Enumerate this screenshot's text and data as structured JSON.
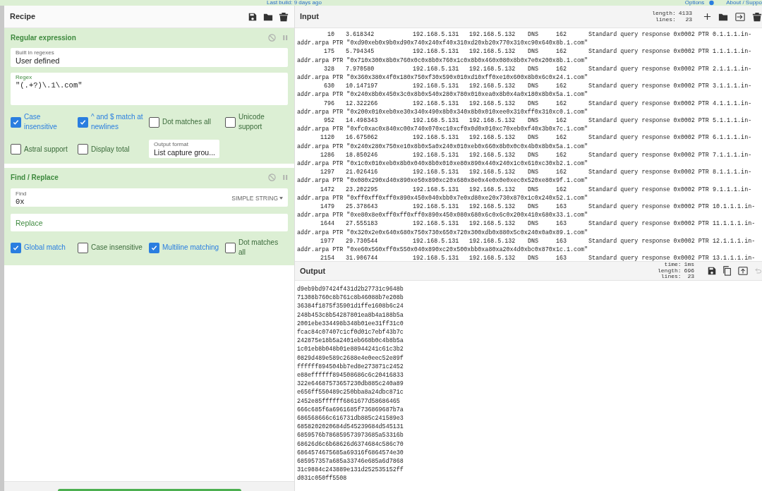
{
  "top_bar": {
    "build": "Last build: 9 days ago",
    "options": "Options",
    "about": "About / Suppo"
  },
  "recipe": {
    "title": "Recipe",
    "operations": [
      {
        "kind": "regex",
        "title": "Regular expression",
        "built_in": {
          "label": "Built in regexes",
          "value": "User defined"
        },
        "regex": {
          "label": "Regex",
          "value": "\"(.+?)\\.1\\.com\""
        },
        "options": [
          {
            "label": "Case insensitive",
            "checked": true
          },
          {
            "label": "^ and $ match at newlines",
            "checked": true
          },
          {
            "label": "Dot matches all",
            "checked": false
          },
          {
            "label": "Unicode support",
            "checked": false
          },
          {
            "label": "Astral support",
            "checked": false
          },
          {
            "label": "Display total",
            "checked": false
          }
        ],
        "output_format": {
          "label": "Output format",
          "value": "List capture grou..."
        }
      },
      {
        "kind": "find_replace",
        "title": "Find / Replace",
        "find": {
          "label": "Find",
          "value": "0x",
          "mode": "SIMPLE STRING"
        },
        "replace": {
          "placeholder": "Replace"
        },
        "options": [
          {
            "label": "Global match",
            "checked": true
          },
          {
            "label": "Case insensitive",
            "checked": false
          },
          {
            "label": "Multiline matching",
            "checked": true
          },
          {
            "label": "Dot matches all",
            "checked": false
          }
        ]
      }
    ]
  },
  "input": {
    "title": "Input",
    "length_label": "length:",
    "length": "4133",
    "lines_label": "lines:",
    "lines": "23",
    "records": [
      {
        "no": "10",
        "time": "3.618342",
        "source": "192.168.5.131",
        "destination": "192.168.5.132",
        "protocol": "DNS",
        "length": "162",
        "info": "Standard query response 0x0002 PTR 0.1.1.1.in-",
        "continuation": "addr.arpa PTR \"0xd90xeb0x9b0xd90x740x240xf40x310xd20xb20x770x310xc90x640x8b.1.com\""
      },
      {
        "no": "175",
        "time": "5.794345",
        "source": "192.168.5.131",
        "destination": "192.168.5.132",
        "protocol": "DNS",
        "length": "162",
        "info": "Standard query response 0x0002 PTR 1.1.1.1.in-",
        "continuation": "addr.arpa PTR \"0x710x300x8b0x760x0c0x8b0x760x1c0x8b0x460x080x8b0x7e0x200x8b.1.com\""
      },
      {
        "no": "328",
        "time": "7.970580",
        "source": "192.168.5.131",
        "destination": "192.168.5.132",
        "protocol": "DNS",
        "length": "162",
        "info": "Standard query response 0x0002 PTR 2.1.1.1.in-",
        "continuation": "addr.arpa PTR \"0x360x380x4f0x180x750xf30x590x010xd10xff0xe10x600x8b0x6c0x24.1.com\""
      },
      {
        "no": "630",
        "time": "10.147197",
        "source": "192.168.5.131",
        "destination": "192.168.5.132",
        "protocol": "DNS",
        "length": "162",
        "info": "Standard query response 0x0002 PTR 3.1.1.1.in-",
        "continuation": "addr.arpa PTR \"0x240x8b0x450x3c0x8b0x540x280x780x010xea0x8b0x4a0x180x8b0x5a.1.com\""
      },
      {
        "no": "796",
        "time": "12.322266",
        "source": "192.168.5.131",
        "destination": "192.168.5.132",
        "protocol": "DNS",
        "length": "162",
        "info": "Standard query response 0x0002 PTR 4.1.1.1.in-",
        "continuation": "addr.arpa PTR \"0x200x010xeb0xe30x340x490x8b0x340x8b0x010xee0x310xff0x310xc0.1.com\""
      },
      {
        "no": "952",
        "time": "14.498343",
        "source": "192.168.5.131",
        "destination": "192.168.5.132",
        "protocol": "DNS",
        "length": "162",
        "info": "Standard query response 0x0002 PTR 5.1.1.1.in-",
        "continuation": "addr.arpa PTR \"0xfc0xac0x840xc00x740x070xc10xcf0x0d0x010xc70xeb0xf40x3b0x7c.1.com\""
      },
      {
        "no": "1120",
        "time": "16.675062",
        "source": "192.168.5.131",
        "destination": "192.168.5.132",
        "protocol": "DNS",
        "length": "162",
        "info": "Standard query response 0x0002 PTR 6.1.1.1.in-",
        "continuation": "addr.arpa PTR \"0x240x280x750xe10x8b0x5a0x240x010xeb0x660x8b0x0c0x4b0x8b0x5a.1.com\""
      },
      {
        "no": "1286",
        "time": "18.850246",
        "source": "192.168.5.131",
        "destination": "192.168.5.132",
        "protocol": "DNS",
        "length": "162",
        "info": "Standard query response 0x0002 PTR 7.1.1.1.in-",
        "continuation": "addr.arpa PTR \"0x1c0x010xeb0x8b0x040x8b0x010xe80x890x440x240x1c0x610xc30xb2.1.com\""
      },
      {
        "no": "1297",
        "time": "21.026416",
        "source": "192.168.5.131",
        "destination": "192.168.5.132",
        "protocol": "DNS",
        "length": "162",
        "info": "Standard query response 0x0002 PTR 8.1.1.1.in-",
        "continuation": "addr.arpa PTR \"0x080x290xd40x890xe50x890xc20x680x8e0x4e0x0e0xec0x520xe80x9f.1.com\""
      },
      {
        "no": "1472",
        "time": "23.202295",
        "source": "192.168.5.131",
        "destination": "192.168.5.132",
        "protocol": "DNS",
        "length": "162",
        "info": "Standard query response 0x0002 PTR 9.1.1.1.in-",
        "continuation": "addr.arpa PTR \"0xff0xff0xff0x890x450x040xbb0x7e0xd80xe20x730x870x1c0x240x52.1.com\""
      },
      {
        "no": "1479",
        "time": "25.378643",
        "source": "192.168.5.131",
        "destination": "192.168.5.132",
        "protocol": "DNS",
        "length": "163",
        "info": "Standard query response 0x0002 PTR 10.1.1.1.in-",
        "continuation": "addr.arpa PTR \"0xe80x8e0xff0xff0xff0x890x450x080x680x6c0x6c0x200x410x680x33.1.com\""
      },
      {
        "no": "1644",
        "time": "27.555183",
        "source": "192.168.5.131",
        "destination": "192.168.5.132",
        "protocol": "DNS",
        "length": "163",
        "info": "Standard query response 0x0002 PTR 11.1.1.1.in-",
        "continuation": "addr.arpa PTR \"0x320x2e0x640x680x750x730x650x720x300xdb0x880x5c0x240x0a0x89.1.com\""
      },
      {
        "no": "1977",
        "time": "29.730544",
        "source": "192.168.5.131",
        "destination": "192.168.5.132",
        "protocol": "DNS",
        "length": "163",
        "info": "Standard query response 0x0002 PTR 12.1.1.1.in-",
        "continuation": "addr.arpa PTR \"0xe60x560xff0x550x040x890xc20x500xbb0xa80xa20x4d0xbc0x870x1c.1.com\""
      },
      {
        "no": "2154",
        "time": "31.906744",
        "source": "192.168.5.131",
        "destination": "192.168.5.132",
        "protocol": "DNS",
        "length": "163",
        "info": "Standard query response 0x0002 PTR 13.1.1.1.in-"
      }
    ]
  },
  "output": {
    "title": "Output",
    "time_label": "time:",
    "time": "1ms",
    "length_label": "length:",
    "length": "696",
    "lines_label": "lines:",
    "lines": "23",
    "lines_text": [
      "d9eb9bd97424f431d2b27731c9648b",
      "71308b760c8b761c8b46088b7e208b",
      "36384f1875f35901d1ffe1608b6c24",
      "248b453c8b54287801ea8b4a188b5a",
      "2001ebe334498b348b01ee31ff31c0",
      "fcac84c07407c1cf0d01c7ebf43b7c",
      "242875e18b5a2401eb668b0c4b8b5a",
      "1c01eb8b048b01e88944241c61c3b2",
      "0829d489e589c2688e4e0eec52e89f",
      "ffffff894504bb7ed8e273871c2452",
      "e88effffff894508686c6c20416833",
      "322e64687573657230db885c240a89",
      "e656ff550489c250bba8a24dbc871c",
      "2452e85ffffff6861677d58686465",
      "666c685f6a6961685f736869687b7a",
      "686568666c616731db885c241589e3",
      "6858202020684d545239684d545131",
      "6859576b786859573973685a53316b",
      "68626d6c6b68626d6374684c586c70",
      "6864574675685a69316f6864574e30",
      "685957357a685a33746e685a6d7868",
      "31c9884c243889e131d252535152ff",
      "d031c050ff5508"
    ]
  }
}
